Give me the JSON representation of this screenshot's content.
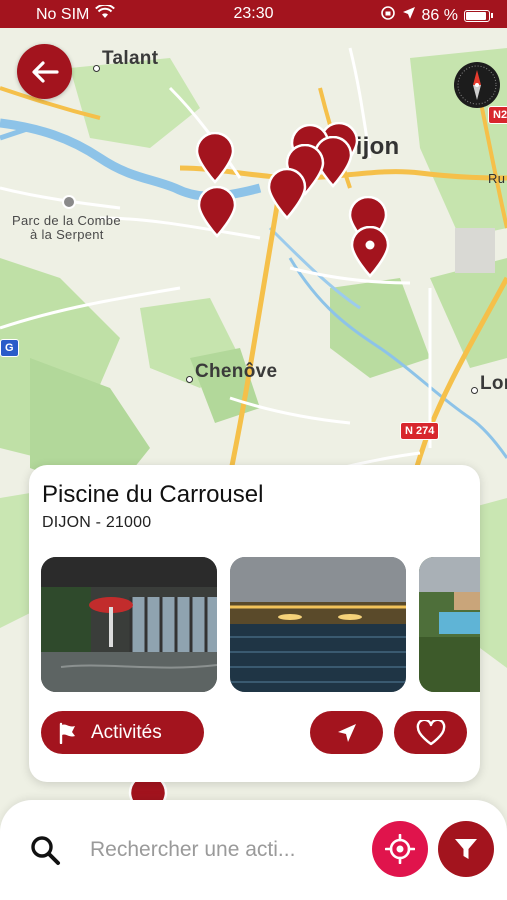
{
  "status": {
    "carrier": "No SIM",
    "time": "23:30",
    "battery": "86 %",
    "icons": [
      "wifi-icon",
      "orientation-lock-icon",
      "location-arrow-icon",
      "battery-icon"
    ]
  },
  "map": {
    "labels": {
      "talant": "Talant",
      "dijon": "Dijon",
      "parc_line1": "Parc de la Combe",
      "parc_line2": "à la Serpent",
      "chenove": "Chenôve",
      "lon": "Lon"
    },
    "road_badges": {
      "n274": "N 274",
      "n2": "N2",
      "ru": "Ru",
      "g": "G"
    },
    "colors": {
      "marker": "#a3141e",
      "land": "#eef0e4",
      "park": "#bfe0a6",
      "water": "#8dc3e8",
      "road_major": "#f5c04a"
    }
  },
  "card": {
    "title": "Piscine du Carrousel",
    "subtitle": "DIJON - 21000",
    "photos": [
      "indoor-pool-photo",
      "outdoor-pool-night-photo",
      "pool-garden-photo"
    ],
    "activities_label": "Activités"
  },
  "search": {
    "placeholder": "Rechercher une acti..."
  },
  "colors": {
    "primary": "#a3141e",
    "accent": "#e0144c"
  }
}
